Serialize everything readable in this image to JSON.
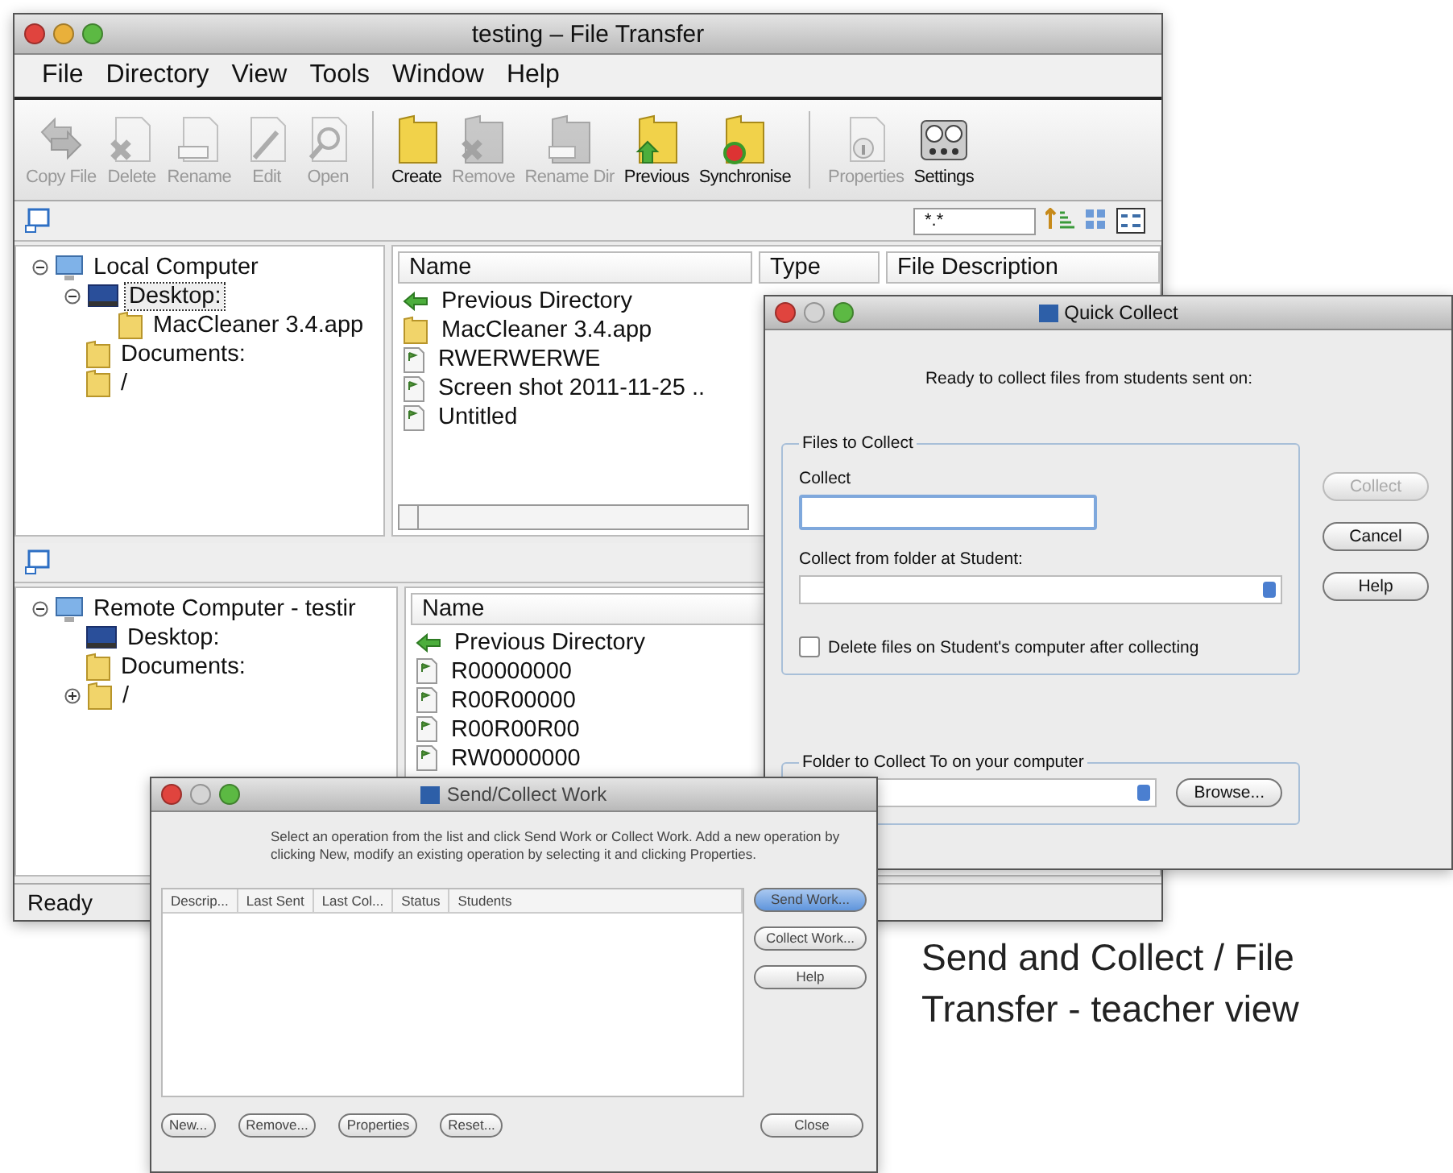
{
  "file_transfer_window": {
    "title": "testing – File Transfer",
    "minimize_enabled": true,
    "menu": [
      "File",
      "Directory",
      "View",
      "Tools",
      "Window",
      "Help"
    ],
    "toolbar": {
      "groups": [
        {
          "buttons": [
            {
              "label": "Copy File",
              "disabled": true
            },
            {
              "label": "Delete",
              "disabled": true
            },
            {
              "label": "Rename",
              "disabled": true
            },
            {
              "label": "Edit",
              "disabled": true
            },
            {
              "label": "Open",
              "disabled": true
            }
          ]
        },
        {
          "buttons": [
            {
              "label": "Create",
              "disabled": false
            },
            {
              "label": "Remove",
              "disabled": true
            },
            {
              "label": "Rename Dir",
              "disabled": true
            },
            {
              "label": "Previous",
              "disabled": false
            },
            {
              "label": "Synchronise",
              "disabled": false
            }
          ]
        },
        {
          "buttons": [
            {
              "label": "Properties",
              "disabled": true
            },
            {
              "label": "Settings",
              "disabled": false
            }
          ]
        }
      ]
    },
    "filter": {
      "value": "*.*"
    },
    "local": {
      "tree": [
        {
          "label": "Local Computer",
          "kind": "computer",
          "expanded": true,
          "selected": false,
          "children": [
            {
              "label": "Desktop:",
              "kind": "desktop",
              "expanded": true,
              "selected": true,
              "children": [
                {
                  "label": "MacCleaner 3.4.app",
                  "kind": "folder",
                  "selected": false
                }
              ]
            },
            {
              "label": "Documents:",
              "kind": "folder",
              "selected": false
            },
            {
              "label": "/",
              "kind": "folder",
              "selected": false
            }
          ]
        }
      ],
      "columns": [
        "Name",
        "Type",
        "File Description"
      ],
      "rows": [
        {
          "name": "Previous Directory",
          "kind": "up"
        },
        {
          "name": "MacCleaner 3.4.app",
          "kind": "folder"
        },
        {
          "name": "RWERWERWE",
          "kind": "file"
        },
        {
          "name": "Screen shot 2011-11-25 ..",
          "kind": "file"
        },
        {
          "name": "Untitled",
          "kind": "file"
        }
      ]
    },
    "remote": {
      "tree": [
        {
          "label": "Remote Computer - testir",
          "kind": "computer",
          "expanded": true,
          "selected": false,
          "children": [
            {
              "label": "Desktop:",
              "kind": "desktop",
              "selected": false
            },
            {
              "label": "Documents:",
              "kind": "folder",
              "selected": false
            },
            {
              "label": "/",
              "kind": "folder",
              "expanded": false,
              "selected": false
            }
          ]
        }
      ],
      "columns": [
        "Name"
      ],
      "rows": [
        {
          "name": "Previous Directory",
          "kind": "up"
        },
        {
          "name": "R00000000",
          "kind": "file"
        },
        {
          "name": "R00R00000",
          "kind": "file"
        },
        {
          "name": "R00R00R00",
          "kind": "file"
        },
        {
          "name": "RW0000000",
          "kind": "file"
        }
      ]
    },
    "status_bar": "Ready"
  },
  "quick_collect_dialog": {
    "title": "Quick Collect",
    "minimize_enabled": false,
    "message": "Ready to collect files from students sent on:",
    "files_group": {
      "legend": "Files to Collect",
      "collect_label": "Collect",
      "folder_label": "Collect from folder at Student:",
      "delete_checkbox": {
        "label": "Delete files on Student's computer after collecting",
        "checked": false
      }
    },
    "buttons": [
      {
        "label": "Collect",
        "disabled": true
      },
      {
        "label": "Cancel",
        "disabled": false
      },
      {
        "label": "Help",
        "disabled": false
      }
    ],
    "destination_group": {
      "legend": "Folder to Collect To on your computer",
      "browse_button": "Browse..."
    }
  },
  "send_collect_dialog": {
    "title": "Send/Collect Work",
    "minimize_enabled": false,
    "message": "Select an operation from the list and click Send Work or Collect Work. Add a new operation by clicking New, modify an existing operation by selecting it and clicking Properties.",
    "columns": [
      "Descrip...",
      "Last Sent",
      "Last Col...",
      "Status",
      "Students"
    ],
    "side_buttons": [
      {
        "label": "Send Work...",
        "default": true
      },
      {
        "label": "Collect Work...",
        "default": false
      },
      {
        "label": "Help",
        "default": false
      }
    ],
    "bottom_buttons": [
      "New...",
      "Remove...",
      "Properties",
      "Reset..."
    ],
    "close_button": "Close"
  },
  "caption": "Send and Collect / File Transfer - teacher view"
}
